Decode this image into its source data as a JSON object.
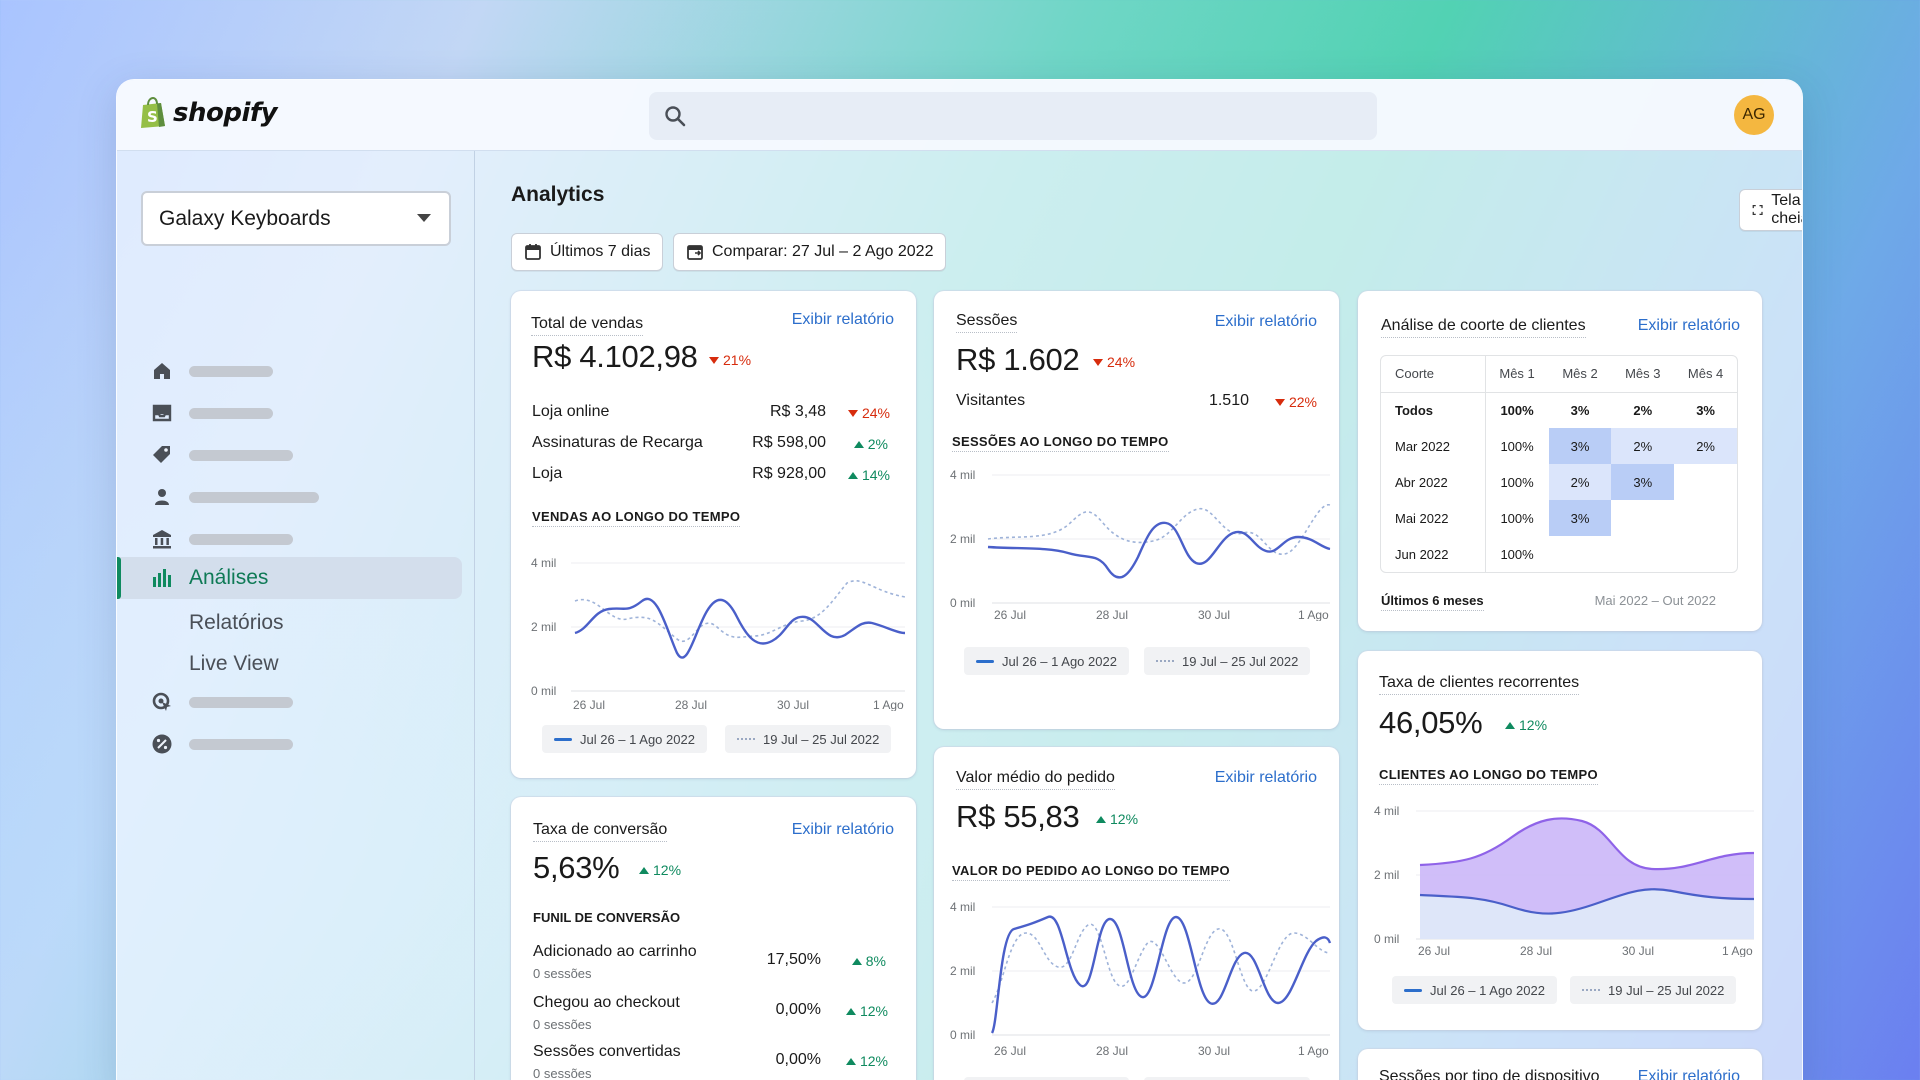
{
  "brand": {
    "name": "shopify"
  },
  "user": {
    "initials": "AG"
  },
  "search": {
    "placeholder": ""
  },
  "sidebar": {
    "store": "Galaxy Keyboards",
    "active": "Análises",
    "sub_items": [
      "Relatórios",
      "Live View"
    ]
  },
  "page": {
    "title": "Analytics",
    "date_range": "Últimos 7 dias",
    "compare": "Comparar: 27 Jul – 2 Ago 2022",
    "fullscreen": "Tela cheia"
  },
  "common": {
    "view_report": "Exibir relatório",
    "legend_current": "Jul 26 – 1 Ago 2022",
    "legend_previous": "19 Jul – 25 Jul 2022",
    "x_ticks": [
      "26 Jul",
      "28 Jul",
      "30 Jul",
      "1 Ago"
    ],
    "y_ticks": [
      "4 mil",
      "2 mil",
      "0 mil"
    ]
  },
  "sales": {
    "title": "Total de vendas",
    "value": "R$ 4.102,98",
    "delta": "21%",
    "rows": [
      {
        "label": "Loja online",
        "value": "R$ 3,48",
        "delta": "24%",
        "dir": "down"
      },
      {
        "label": "Assinaturas de Recarga",
        "value": "R$ 598,00",
        "delta": "2%",
        "dir": "up"
      },
      {
        "label": "Loja",
        "value": "R$ 928,00",
        "delta": "14%",
        "dir": "up"
      }
    ],
    "chart_label": "VENDAS AO LONGO DO TEMPO"
  },
  "sessions": {
    "title": "Sessões",
    "value": "R$ 1.602",
    "delta": "24%",
    "visitors_label": "Visitantes",
    "visitors_value": "1.510",
    "visitors_delta": "22%",
    "chart_label": "SESSÕES AO LONGO DO TEMPO"
  },
  "cohort": {
    "title": "Análise de coorte de clientes",
    "headers": [
      "Coorte",
      "Mês 1",
      "Mês 2",
      "Mês 3",
      "Mês 4"
    ],
    "rows": [
      {
        "label": "Todos",
        "values": [
          "100%",
          "3%",
          "2%",
          "3%"
        ]
      },
      {
        "label": "Mar 2022",
        "values": [
          "100%",
          "3%",
          "2%",
          "2%"
        ]
      },
      {
        "label": "Abr 2022",
        "values": [
          "100%",
          "2%",
          "3%",
          ""
        ]
      },
      {
        "label": "Mai 2022",
        "values": [
          "100%",
          "3%",
          "",
          ""
        ]
      },
      {
        "label": "Jun 2022",
        "values": [
          "100%",
          "",
          "",
          ""
        ]
      }
    ],
    "footer_left": "Últimos 6 meses",
    "footer_right": "Mai 2022 – Out 2022"
  },
  "conversion": {
    "title": "Taxa de conversão",
    "value": "5,63%",
    "delta": "12%",
    "funnel_label": "FUNIL DE CONVERSÃO",
    "rows": [
      {
        "label": "Adicionado ao carrinho",
        "sub": "0 sessões",
        "value": "17,50%",
        "delta": "8%"
      },
      {
        "label": "Chegou ao checkout",
        "sub": "0 sessões",
        "value": "0,00%",
        "delta": "12%"
      },
      {
        "label": "Sessões convertidas",
        "sub": "0 sessões",
        "value": "0,00%",
        "delta": "12%"
      }
    ]
  },
  "aov": {
    "title": "Valor médio do pedido",
    "value": "R$ 55,83",
    "delta": "12%",
    "chart_label": "VALOR DO PEDIDO AO LONGO DO TEMPO"
  },
  "returning": {
    "title": "Taxa de clientes recorrentes",
    "value": "46,05%",
    "delta": "12%",
    "chart_label": "CLIENTES AO LONGO DO TEMPO"
  },
  "devices": {
    "title": "Sessões por tipo de dispositivo"
  },
  "colors": {
    "accent": "#2c6ecb",
    "positive": "#0f8a5f",
    "negative": "#d72c0d",
    "chart_line": "#4a5fc9",
    "chart_prev": "#9fb3d9",
    "area_top": "#c9b5f7"
  }
}
